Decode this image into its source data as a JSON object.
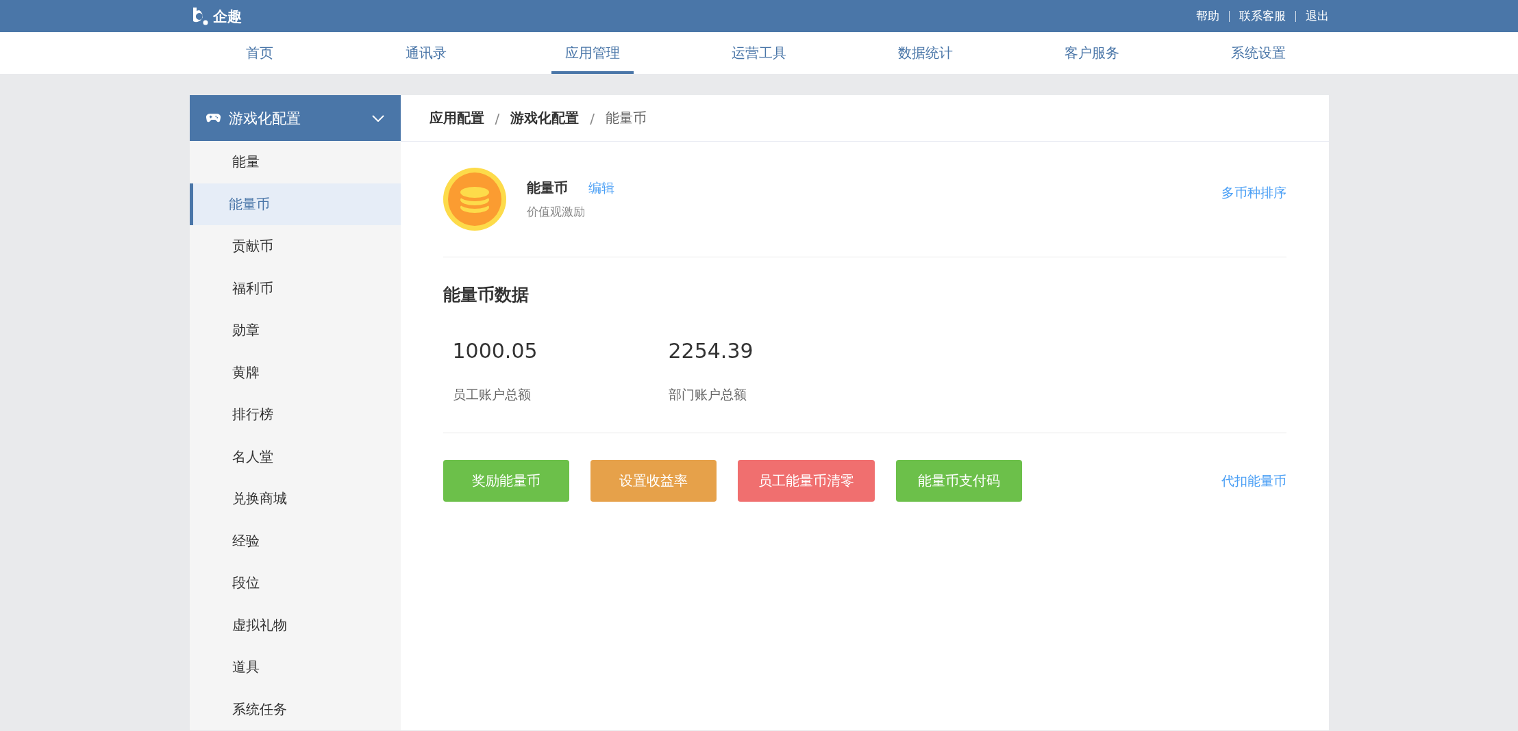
{
  "topbar": {
    "logo": "企趣",
    "links": [
      "帮助",
      "联系客服",
      "退出"
    ]
  },
  "nav": [
    {
      "label": "首页",
      "selected": false
    },
    {
      "label": "通讯录",
      "selected": false
    },
    {
      "label": "应用管理",
      "selected": true
    },
    {
      "label": "运营工具",
      "selected": false
    },
    {
      "label": "数据统计",
      "selected": false
    },
    {
      "label": "客户服务",
      "selected": false
    },
    {
      "label": "系统设置",
      "selected": false
    }
  ],
  "sidebar": {
    "title": "游戏化配置",
    "expanded": true,
    "items": [
      {
        "label": "能量",
        "selected": false
      },
      {
        "label": "能量币",
        "selected": true
      },
      {
        "label": "贡献币",
        "selected": false
      },
      {
        "label": "福利币",
        "selected": false
      },
      {
        "label": "勋章",
        "selected": false
      },
      {
        "label": "黄牌",
        "selected": false
      },
      {
        "label": "排行榜",
        "selected": false
      },
      {
        "label": "名人堂",
        "selected": false
      },
      {
        "label": "兑换商城",
        "selected": false
      },
      {
        "label": "经验",
        "selected": false
      },
      {
        "label": "段位",
        "selected": false
      },
      {
        "label": "虚拟礼物",
        "selected": false
      },
      {
        "label": "道具",
        "selected": false
      },
      {
        "label": "系统任务",
        "selected": false
      }
    ]
  },
  "breadcrumb": [
    "应用配置",
    "游戏化配置",
    "能量币"
  ],
  "breadcrumb_separator": "/",
  "currency": {
    "name": "能量币",
    "edit": "编辑",
    "subtitle": "价值观激励",
    "sort_link": "多币种排序"
  },
  "data_section": {
    "title": "能量币数据",
    "stats": [
      {
        "value": "1000.05",
        "label": "员工账户总额"
      },
      {
        "value": "2254.39",
        "label": "部门账户总额"
      }
    ]
  },
  "actions": [
    {
      "label": "奖励能量币",
      "color": "#6cc04a"
    },
    {
      "label": "设置收益率",
      "color": "#e6a14a"
    },
    {
      "label": "员工能量币清零",
      "color": "#f06f6f"
    },
    {
      "label": "能量币支付码",
      "color": "#6cc04a"
    }
  ],
  "deduct_link": "代扣能量币"
}
